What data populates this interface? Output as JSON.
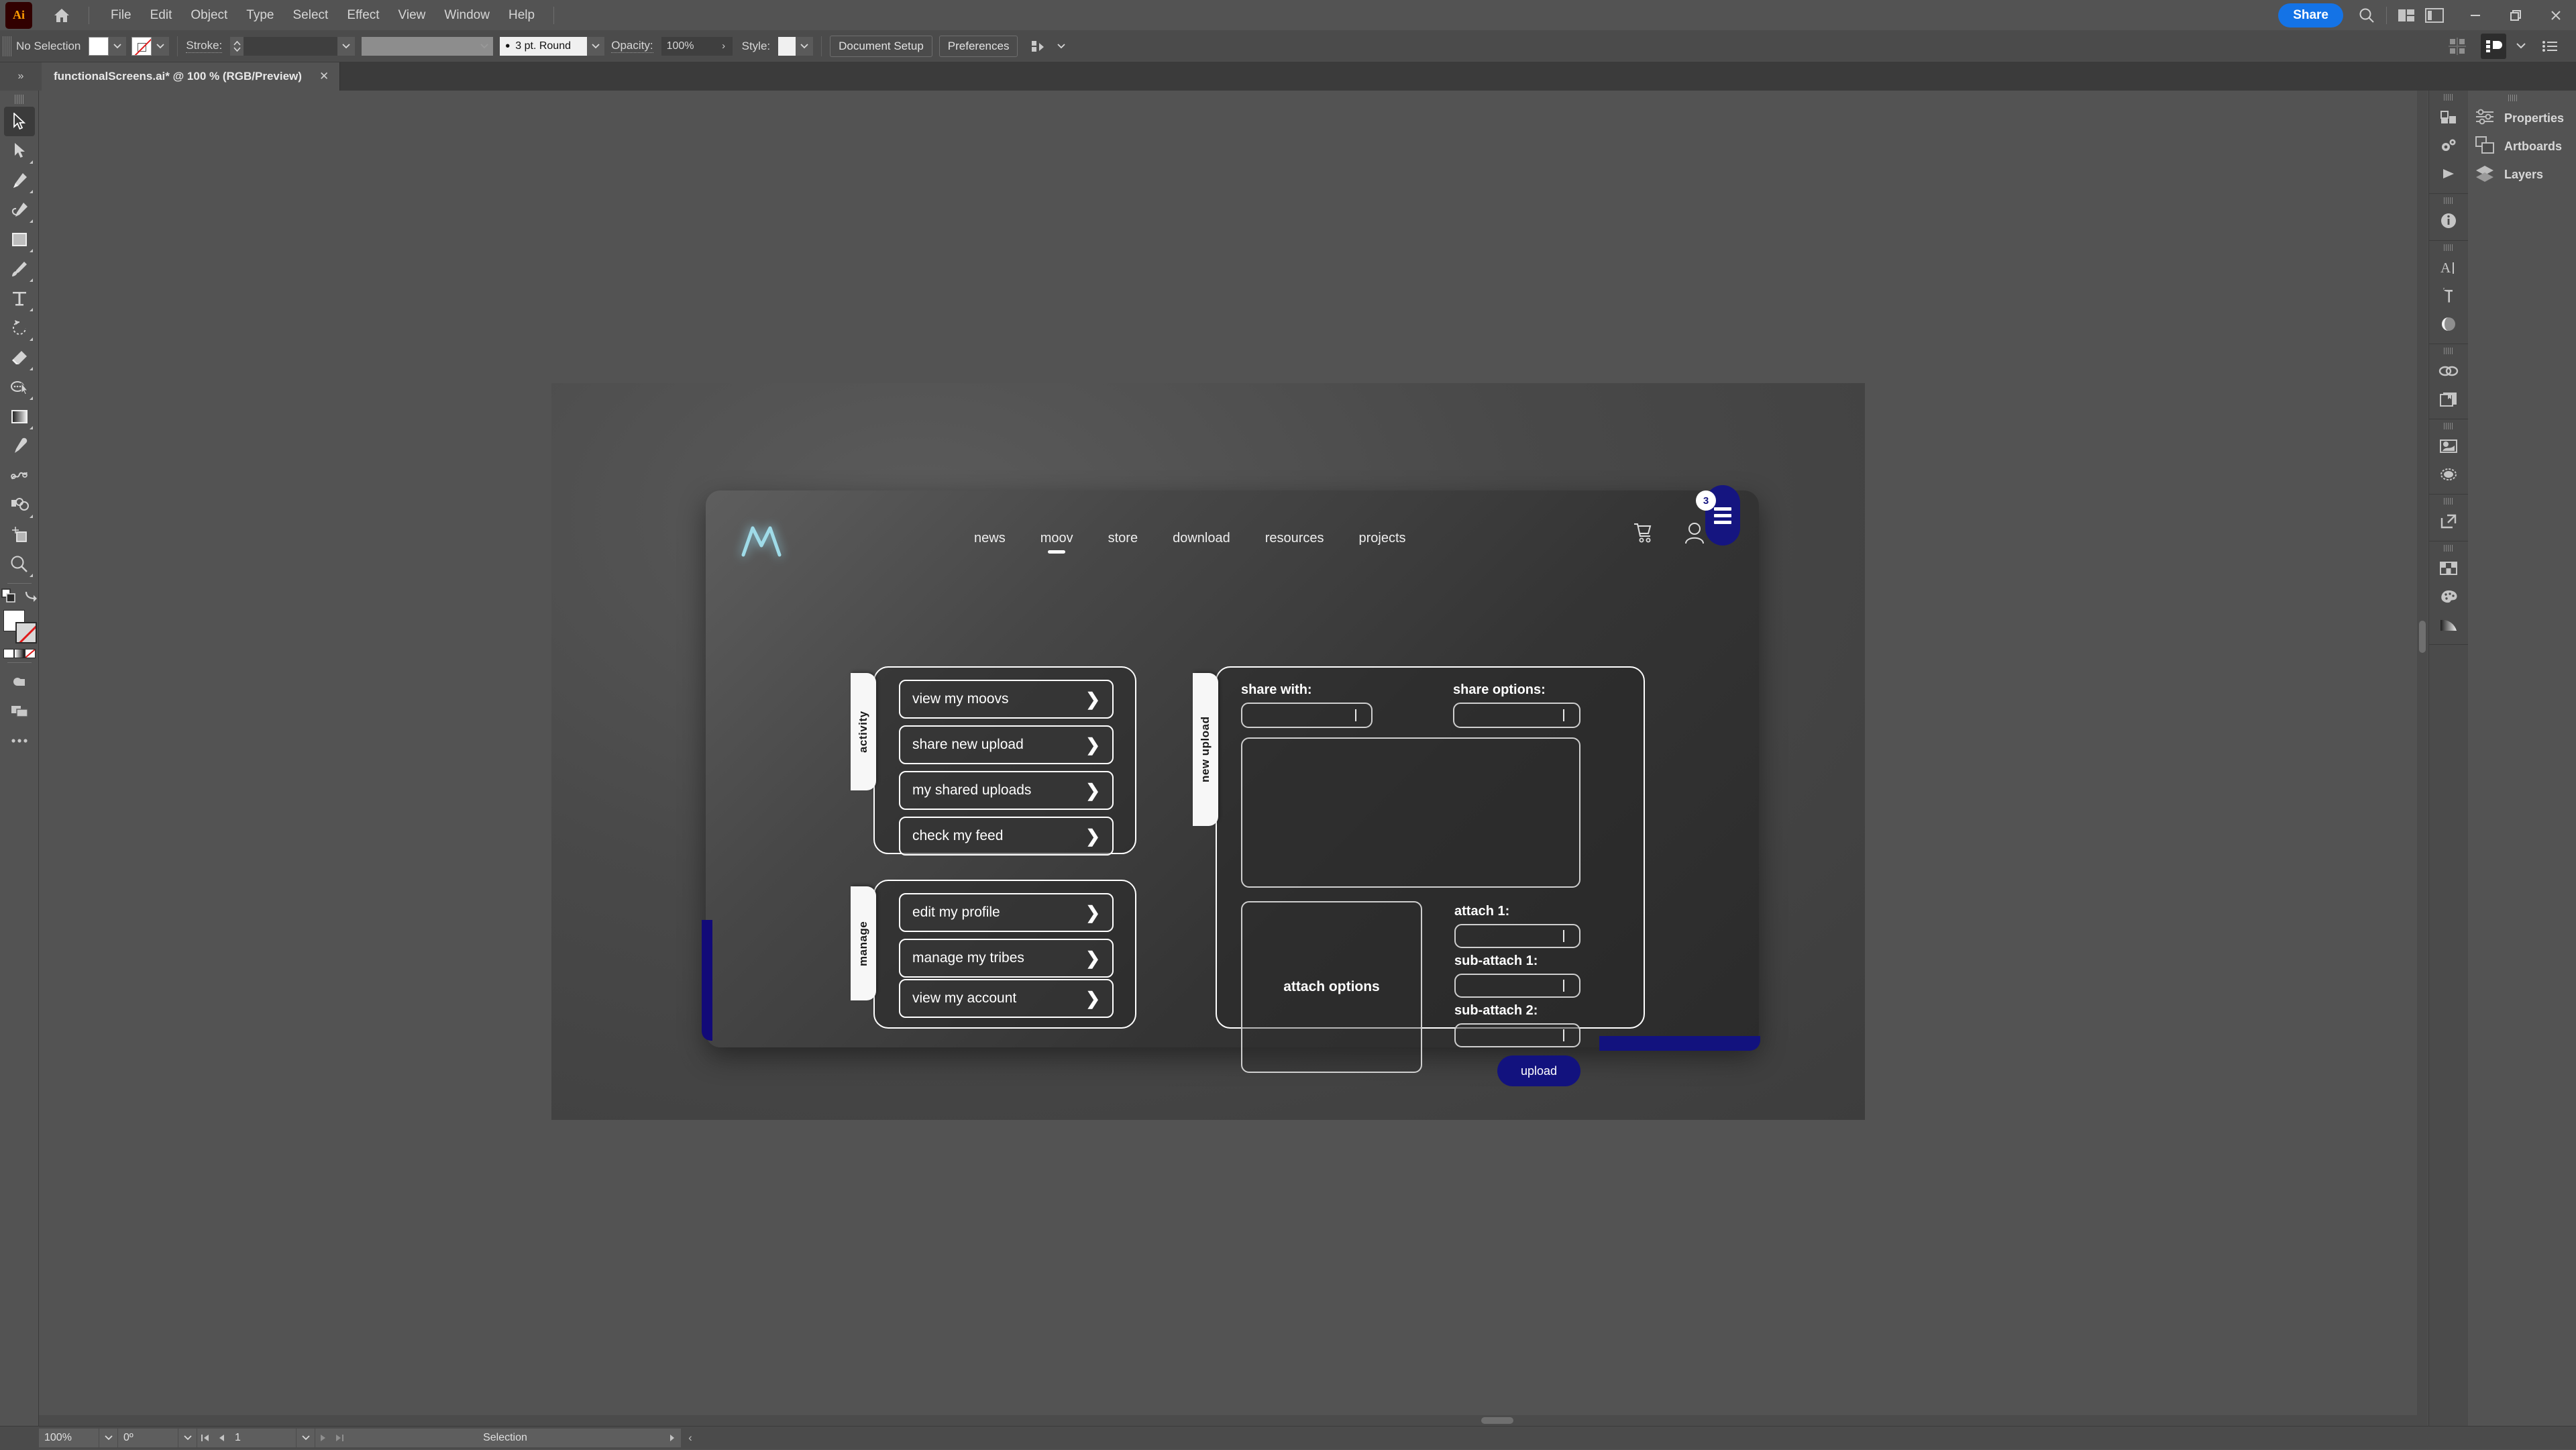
{
  "app": {
    "logo_text": "Ai",
    "home_icon": "home-icon"
  },
  "menubar": {
    "items": [
      "File",
      "Edit",
      "Object",
      "Type",
      "Select",
      "Effect",
      "View",
      "Window",
      "Help"
    ],
    "share_label": "Share",
    "search_icon": "search-icon",
    "arrange_icon": "arrange-documents-icon",
    "workspace_icon": "workspace-switcher-icon",
    "minimize_icon": "minimize-icon",
    "maximize_icon": "maximize-icon",
    "close_icon": "close-icon"
  },
  "controlbar": {
    "selection_status": "No Selection",
    "fill_swatch": "fill-swatch-white",
    "stroke_swatch": "stroke-swatch-none",
    "stroke_label": "Stroke:",
    "stroke_weight": "",
    "stroke_profile": "",
    "brush_definition": "3 pt. Round",
    "opacity_label": "Opacity:",
    "opacity_value": "100%",
    "style_label": "Style:",
    "document_setup_label": "Document Setup",
    "preferences_label": "Preferences"
  },
  "document_tab": {
    "title": "functionalScreens.ai* @ 100 % (RGB/Preview)",
    "close_icon": "close-icon",
    "chevrons": "»"
  },
  "toolbar": {
    "tools": [
      {
        "name": "selection-tool",
        "active": true
      },
      {
        "name": "direct-selection-tool",
        "active": false
      },
      {
        "name": "pen-tool",
        "active": false
      },
      {
        "name": "curvature-tool",
        "active": false
      },
      {
        "name": "rectangle-tool",
        "active": false
      },
      {
        "name": "paintbrush-tool",
        "active": false
      },
      {
        "name": "type-tool",
        "active": false
      },
      {
        "name": "rotate-tool",
        "active": false
      },
      {
        "name": "eraser-tool",
        "active": false
      },
      {
        "name": "shape-builder-tool",
        "active": false
      },
      {
        "name": "gradient-tool",
        "active": false
      },
      {
        "name": "eyedropper-tool",
        "active": false
      },
      {
        "name": "blend-tool",
        "active": false
      },
      {
        "name": "symbol-sprayer-tool",
        "active": false
      },
      {
        "name": "artboard-tool",
        "active": false
      },
      {
        "name": "zoom-tool",
        "active": false
      }
    ],
    "more_tools_icon": "more-tools-icon",
    "swap-fill-stroke-icon": "swap-fill-stroke-icon",
    "fill_color": "#ffffff",
    "stroke_color": "none"
  },
  "rightdock": {
    "groups": [
      [
        "chart-icon",
        "gears-icon",
        "play-icon"
      ],
      [
        "info-icon"
      ],
      [
        "character-icon",
        "paragraph-icon",
        "opacity-icon"
      ],
      [
        "links-icon",
        "artboards-icon"
      ],
      [
        "image-trace-icon",
        "gradient-mesh-icon"
      ],
      [
        "export-icon"
      ],
      [
        "swatches-icon",
        "color-palette-icon",
        "color-guide-icon"
      ]
    ],
    "labels": [
      {
        "icon": "properties-icon",
        "label": "Properties"
      },
      {
        "icon": "artboards-panel-icon",
        "label": "Artboards"
      },
      {
        "icon": "layers-icon",
        "label": "Layers"
      }
    ]
  },
  "statusbar": {
    "zoom": "100%",
    "rotation": "0º",
    "artboard_number": "1",
    "tool_status": "Selection",
    "first_icon": "first-artboard-icon",
    "prev_icon": "previous-artboard-icon",
    "next_icon": "next-artboard-icon",
    "last_icon": "last-artboard-icon"
  },
  "mockup": {
    "logo": "moov-logo-icon",
    "nav": [
      {
        "label": "news",
        "active": false
      },
      {
        "label": "moov",
        "active": true
      },
      {
        "label": "store",
        "active": false
      },
      {
        "label": "download",
        "active": false
      },
      {
        "label": "resources",
        "active": false
      },
      {
        "label": "projects",
        "active": false
      }
    ],
    "cart_icon": "shopping-cart-icon",
    "account_icon": "user-account-icon",
    "menu_icon": "hamburger-menu-icon",
    "menu_badge": "3",
    "accent_navy": "#12127e",
    "accent_cyan": "#9fdbe8",
    "activity_panel": {
      "tab_label": "activity",
      "buttons": [
        "view my moovs",
        "share new upload",
        "my shared uploads",
        "check my feed"
      ]
    },
    "manage_panel": {
      "tab_label": "manage",
      "buttons": [
        "edit my profile",
        "manage my tribes",
        "view my account"
      ]
    },
    "upload_panel": {
      "tab_label": "new upload",
      "share_with_label": "share with:",
      "share_with_value": "",
      "share_options_label": "share options:",
      "share_options_value": "",
      "attach_options_label": "attach options",
      "attach_1_label": "attach 1:",
      "attach_1_value": "",
      "sub_attach_1_label": "sub-attach 1:",
      "sub_attach_1_value": "",
      "sub_attach_2_label": "sub-attach 2:",
      "sub_attach_2_value": "",
      "upload_button_label": "upload"
    }
  }
}
